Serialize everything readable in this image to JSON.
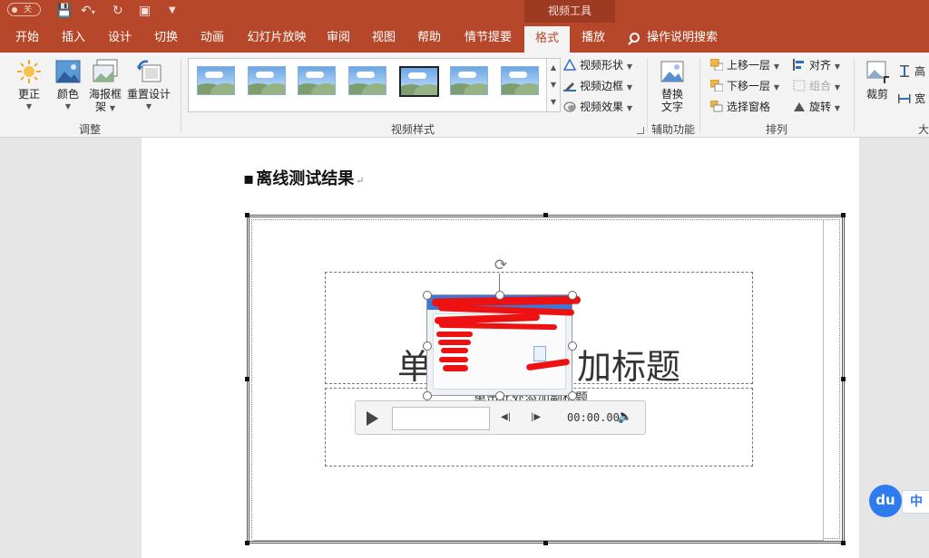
{
  "window": {
    "autosave_label": "关",
    "context_tab_group": "视频工具"
  },
  "tabs": [
    {
      "label": "开始"
    },
    {
      "label": "插入"
    },
    {
      "label": "设计"
    },
    {
      "label": "切换"
    },
    {
      "label": "动画"
    },
    {
      "label": "幻灯片放映"
    },
    {
      "label": "审阅"
    },
    {
      "label": "视图"
    },
    {
      "label": "帮助"
    },
    {
      "label": "情节提要"
    },
    {
      "label": "格式",
      "active": true
    },
    {
      "label": "播放"
    }
  ],
  "tell_me": "操作说明搜索",
  "ribbon": {
    "adjust": {
      "label": "调整",
      "corrections": "更正",
      "color": "颜色",
      "poster_frame_line1": "海报框",
      "poster_frame_line2": "架",
      "reset_design": "重置设计"
    },
    "video_styles": {
      "label": "视频样式",
      "shape": "视频形状",
      "border": "视频边框",
      "effects": "视频效果"
    },
    "accessibility": {
      "label": "辅助功能",
      "alt_text_line1": "替换",
      "alt_text_line2": "文字"
    },
    "arrange": {
      "label": "排列",
      "bring_forward": "上移一层",
      "send_backward": "下移一层",
      "selection_pane": "选择窗格",
      "align": "对齐",
      "group": "组合",
      "rotate": "旋转"
    },
    "size": {
      "label": "大",
      "crop": "裁剪",
      "height": "高",
      "width": "宽"
    }
  },
  "document": {
    "heading": "离线测试结果",
    "slide_title_left": "单",
    "slide_title_right": "加标题",
    "slide_subtitle": "单击此处添加副标题"
  },
  "player": {
    "time": "00:00.00"
  },
  "ime": {
    "badge": "du",
    "mode": "中"
  },
  "colors": {
    "brand": "#b7472a",
    "context_tab": "#9c3a22",
    "ribbon_bg": "#f3f3f3",
    "redaction": "#ee1111"
  },
  "icons": [
    "sun-icon",
    "color-picture-icon",
    "poster-frame-icon",
    "reset-design-icon",
    "video-shape-icon",
    "video-border-icon",
    "video-effects-icon",
    "alt-text-icon",
    "bring-forward-icon",
    "send-backward-icon",
    "selection-pane-icon",
    "align-icon",
    "group-icon",
    "rotate-icon",
    "crop-icon",
    "play-icon",
    "volume-icon",
    "search-icon"
  ]
}
